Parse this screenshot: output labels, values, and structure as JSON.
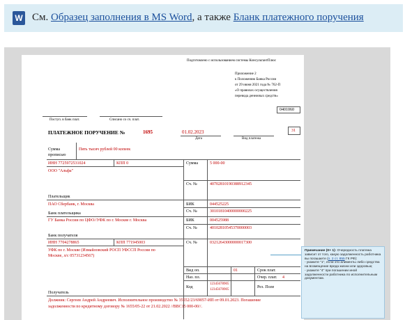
{
  "banner": {
    "prefix": "См.",
    "link1": "Образец заполнения в MS Word",
    "middle": ", а также",
    "link2": "Бланк платежного поручения"
  },
  "doc": {
    "consultant": "Подготовлено с использованием системы КонсультантПлюс",
    "appendix": [
      "Приложение 2",
      "к Положению Банка России",
      "от 29 июня 2021 года № 762-П",
      "«О правилах осуществления",
      "перевода денежных средств»"
    ],
    "form_code": "0401060",
    "received_label": "Поступ. в банк плат.",
    "debited_label": "Списано со сч. плат.",
    "title": "ПЛАТЕЖНОЕ ПОРУЧЕНИЕ №",
    "number": "1695",
    "date": "01.02.2023",
    "date_label": "Дата",
    "paytype_label": "Вид платежа",
    "status_code": "31",
    "sum_words_label": [
      "Сумма",
      "прописью"
    ],
    "sum_words": "Пять тысяч рублей 00 копеек",
    "inn_payer": "ИНН  7725972531024",
    "kpp_payer": "КПП  0",
    "sum_label": "Сумма",
    "sum_value": "5 000-00",
    "payer_name": "ООО \"Альфа\"",
    "account_label": "Сч. №",
    "payer_account": "40702810190388912345",
    "payer_label": "Плательщик",
    "payer_bank": "ПАО Сбербанк, г. Москва",
    "bik_label": "БИК",
    "payer_bik": "044525225",
    "payer_corr": "30101810400000000225",
    "payer_bank_label": "Банк плательщика",
    "recipient_bank": "ГУ Банка России по ЦФО//УФК по г. Москве г. Москва",
    "recipient_bik": "004525988",
    "recipient_corr": "40102810545370000003",
    "recipient_bank_label": "Банк получателя",
    "inn_recipient": "ИНН  7704278865",
    "kpp_recipient": "КПП  771945003",
    "recipient_account": "03212643000000017300",
    "recipient_name": [
      "УФК по г. Москве (Измайловский РОСП УФССП России по",
      "Москве, л/с 05731234567)"
    ],
    "op_type_label": "Вид оп.",
    "op_type": "01",
    "deadline_label": "Срок плат.",
    "purpose_code_label": "Наз. пл.",
    "order_label": "Очер. плат.",
    "order_value": "4",
    "code_label": "Код",
    "code_values": [
      "12345678905",
      "12345678905"
    ],
    "reserve_label": "Рез. Поле",
    "recipient_label": "Получатель",
    "purpose": [
      "Должник: Сергеев Андрей Андреевич. Исполнительное производство № 35552/23/69057-ИП от 09.01.2023. Погашение",
      "задолженности по кредитному договору № 1655/05-22 от 21.02.2022 //ВВС15 000-00//."
    ]
  },
  "note": {
    "title": "Примечание (К+ 1):",
    "text1": "Очередность платежа зависит от того, какую задолженность работника вы погашаете (",
    "link": "п. 2 ст. 855",
    "text2": " ГК РФ):",
    "item1": "- укажите \"1\", если это алименты либо средства на возмещение вреда жизни или здоровью;",
    "item2": "- укажите \"4\" при погашении иной задолженности работника по исполнительным документам."
  }
}
